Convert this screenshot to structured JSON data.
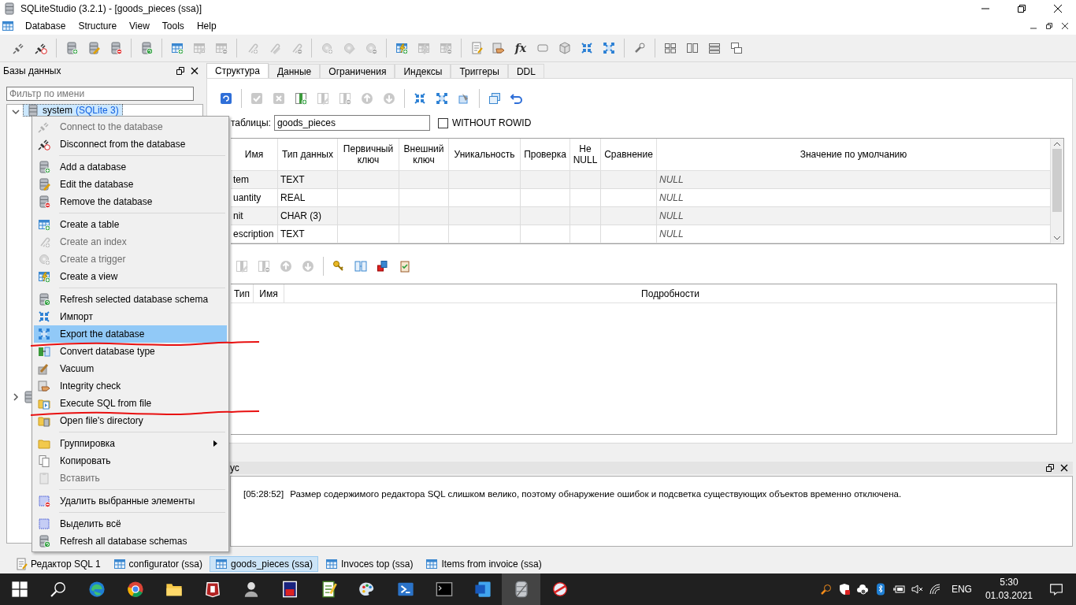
{
  "window": {
    "title": "SQLiteStudio (3.2.1) - [goods_pieces (ssa)]"
  },
  "menu_bar": [
    "Database",
    "Structure",
    "View",
    "Tools",
    "Help"
  ],
  "toolbar": [
    [
      {
        "kind": "plug",
        "disabled": false
      },
      {
        "kind": "unplug",
        "disabled": false
      }
    ],
    [
      {
        "kind": "db_add",
        "disabled": false
      },
      {
        "kind": "db_edit",
        "disabled": false
      },
      {
        "kind": "db_remove",
        "disabled": false
      }
    ],
    [
      {
        "kind": "db_refresh",
        "disabled": false
      }
    ],
    [
      {
        "kind": "table_add",
        "disabled": false
      },
      {
        "kind": "table_edit",
        "disabled": true
      },
      {
        "kind": "table_remove",
        "disabled": true
      }
    ],
    [
      {
        "kind": "index_add",
        "disabled": true
      },
      {
        "kind": "index_edit",
        "disabled": true
      },
      {
        "kind": "index_remove",
        "disabled": true
      }
    ],
    [
      {
        "kind": "trigger_add",
        "disabled": true
      },
      {
        "kind": "trigger_edit",
        "disabled": true
      },
      {
        "kind": "trigger_remove",
        "disabled": true
      }
    ],
    [
      {
        "kind": "view_add",
        "disabled": false
      },
      {
        "kind": "view_edit",
        "disabled": true
      },
      {
        "kind": "view_remove",
        "disabled": true
      }
    ],
    [
      {
        "kind": "sql",
        "disabled": false
      },
      {
        "kind": "hand",
        "disabled": false
      },
      {
        "kind": "text",
        "label": "fx",
        "disabled": false
      },
      {
        "kind": "az",
        "disabled": false
      },
      {
        "kind": "cube",
        "disabled": false
      },
      {
        "kind": "import",
        "disabled": false
      },
      {
        "kind": "export",
        "disabled": false
      }
    ],
    [
      {
        "kind": "wrench",
        "disabled": false
      }
    ],
    [
      {
        "kind": "layout_tile",
        "disabled": false
      },
      {
        "kind": "layout_columns",
        "disabled": false
      },
      {
        "kind": "layout_rows",
        "disabled": false
      },
      {
        "kind": "layout_cascade",
        "disabled": false
      }
    ]
  ],
  "databases_panel": {
    "title": "Базы данных",
    "filter": {
      "placeholder": "Фильтр по имени"
    },
    "tree": [
      {
        "label": "system",
        "note": "(SQLite 3)",
        "expanded": true,
        "selected": true
      },
      {
        "expanded": false
      }
    ]
  },
  "editor": {
    "tabs": [
      {
        "label": "Структура",
        "selected": true
      },
      {
        "label": "Данные",
        "selected": false
      },
      {
        "label": "Ограничения",
        "selected": false
      },
      {
        "label": "Индексы",
        "selected": false
      },
      {
        "label": "Триггеры",
        "selected": false
      },
      {
        "label": "DDL",
        "selected": false
      }
    ],
    "toolbar": [
      [
        {
          "kind": "refresh",
          "disabled": false
        }
      ],
      [
        {
          "kind": "check",
          "disabled": true
        },
        {
          "kind": "cross",
          "disabled": true
        },
        {
          "kind": "column_add",
          "disabled": false
        },
        {
          "kind": "column_edit",
          "disabled": true
        },
        {
          "kind": "column_remove",
          "disabled": true
        },
        {
          "kind": "up",
          "disabled": true
        },
        {
          "kind": "down",
          "disabled": true
        }
      ],
      [
        {
          "kind": "import",
          "disabled": false
        },
        {
          "kind": "export",
          "disabled": false
        },
        {
          "kind": "populate",
          "disabled": false
        }
      ],
      [
        {
          "kind": "similar",
          "disabled": false
        },
        {
          "kind": "undo",
          "disabled": false
        }
      ]
    ],
    "table_name": {
      "label": "таблицы:",
      "value": "goods_pieces"
    },
    "without_rowid": {
      "label": "WITHOUT ROWID",
      "checked": false
    },
    "columns": [
      "Имя",
      "Тип данных",
      "Первичный ключ",
      "Внешний ключ",
      "Уникальность",
      "Проверка",
      "Не NULL",
      "Сравнение",
      "Значение по умолчанию"
    ],
    "rows": [
      {
        "name": "tem",
        "type": "TEXT",
        "default": "NULL"
      },
      {
        "name": "uantity",
        "type": "REAL",
        "default": "NULL"
      },
      {
        "name": "nit",
        "type": "CHAR (3)",
        "default": "NULL"
      },
      {
        "name": "escription",
        "type": "TEXT",
        "default": "NULL"
      }
    ],
    "constraints_toolbar": [
      [
        {
          "kind": "column_edit",
          "disabled": true
        },
        {
          "kind": "column_remove",
          "disabled": true
        },
        {
          "kind": "up",
          "disabled": true
        },
        {
          "kind": "down",
          "disabled": true
        }
      ],
      [
        {
          "kind": "key",
          "disabled": false
        },
        {
          "kind": "fk",
          "disabled": false
        },
        {
          "kind": "unique",
          "disabled": false
        },
        {
          "kind": "clipboard",
          "disabled": false
        }
      ]
    ],
    "constraints_columns": [
      "Тип",
      "Имя",
      "Подробности"
    ]
  },
  "status_dock": {
    "title": "ус",
    "messages": [
      {
        "time": "[05:28:52]",
        "text": "Размер содержимого редактора SQL слишком велико, поэтому обнаружение ошибок и подсветка существующих объектов временно отключена."
      }
    ]
  },
  "window_tabs": [
    {
      "label": "Редактор SQL 1",
      "kind": "sql",
      "selected": false
    },
    {
      "label": "configurator (ssa)",
      "kind": "table",
      "selected": false
    },
    {
      "label": "goods_pieces (ssa)",
      "kind": "table",
      "selected": true
    },
    {
      "label": "Invoces top (ssa)",
      "kind": "table",
      "selected": false
    },
    {
      "label": "Items from invoice (ssa)",
      "kind": "table",
      "selected": false
    }
  ],
  "context_menu": {
    "items": [
      {
        "kind": "plug",
        "label": "Connect to the database",
        "disabled": true,
        "selected": false,
        "underlined": false,
        "submenu": false
      },
      {
        "kind": "unplug",
        "label": "Disconnect from the database",
        "disabled": false,
        "selected": false,
        "underlined": false,
        "submenu": false
      },
      {
        "kind": "separator"
      },
      {
        "kind": "db_add",
        "label": "Add a database",
        "disabled": false,
        "selected": false,
        "underlined": false,
        "submenu": false
      },
      {
        "kind": "db_edit",
        "label": "Edit the database",
        "disabled": false,
        "selected": false,
        "underlined": false,
        "submenu": false
      },
      {
        "kind": "db_remove",
        "label": "Remove the database",
        "disabled": false,
        "selected": false,
        "underlined": false,
        "submenu": false
      },
      {
        "kind": "separator"
      },
      {
        "kind": "table_add",
        "label": "Create a table",
        "disabled": false,
        "selected": false,
        "underlined": false,
        "submenu": false
      },
      {
        "kind": "index_add",
        "label": "Create an index",
        "disabled": true,
        "selected": false,
        "underlined": false,
        "submenu": false
      },
      {
        "kind": "trigger_add",
        "label": "Create a trigger",
        "disabled": true,
        "selected": false,
        "underlined": false,
        "submenu": false
      },
      {
        "kind": "view_add",
        "label": "Create a view",
        "disabled": false,
        "selected": false,
        "underlined": false,
        "submenu": false
      },
      {
        "kind": "separator"
      },
      {
        "kind": "db_refresh",
        "label": "Refresh selected database schema",
        "disabled": false,
        "selected": false,
        "underlined": false,
        "submenu": false
      },
      {
        "kind": "import",
        "label": "Импорт",
        "disabled": false,
        "selected": false,
        "underlined": false,
        "submenu": false
      },
      {
        "kind": "export",
        "label": "Export the database",
        "disabled": false,
        "selected": true,
        "underlined": true,
        "submenu": false
      },
      {
        "kind": "convert",
        "label": "Convert database type",
        "disabled": false,
        "selected": false,
        "underlined": false,
        "submenu": false
      },
      {
        "kind": "brush",
        "label": "Vacuum",
        "disabled": false,
        "selected": false,
        "underlined": false,
        "submenu": false
      },
      {
        "kind": "hand",
        "label": "Integrity check",
        "disabled": false,
        "selected": false,
        "underlined": false,
        "submenu": false
      },
      {
        "kind": "execfile",
        "label": "Execute SQL from file",
        "disabled": false,
        "selected": false,
        "underlined": true,
        "submenu": false
      },
      {
        "kind": "opendir",
        "label": "Open file's directory",
        "disabled": false,
        "selected": false,
        "underlined": false,
        "submenu": false
      },
      {
        "kind": "separator"
      },
      {
        "kind": "folder",
        "label": "Группировка",
        "disabled": false,
        "selected": false,
        "underlined": false,
        "submenu": true
      },
      {
        "kind": "copy",
        "label": "Копировать",
        "disabled": false,
        "selected": false,
        "underlined": false,
        "submenu": false
      },
      {
        "kind": "paste",
        "label": "Вставить",
        "disabled": true,
        "selected": false,
        "underlined": false,
        "submenu": false
      },
      {
        "kind": "separator"
      },
      {
        "kind": "select_remove",
        "label": "Удалить выбранные элементы",
        "disabled": false,
        "selected": false,
        "underlined": false,
        "submenu": false
      },
      {
        "kind": "separator"
      },
      {
        "kind": "select",
        "label": "Выделить всё",
        "disabled": false,
        "selected": false,
        "underlined": false,
        "submenu": false
      },
      {
        "kind": "db_refresh",
        "label": "Refresh all database schemas",
        "disabled": false,
        "selected": false,
        "underlined": false,
        "submenu": false
      }
    ]
  },
  "taskbar": {
    "language": "ENG",
    "time": "5:30",
    "date": "01.03.2021"
  }
}
